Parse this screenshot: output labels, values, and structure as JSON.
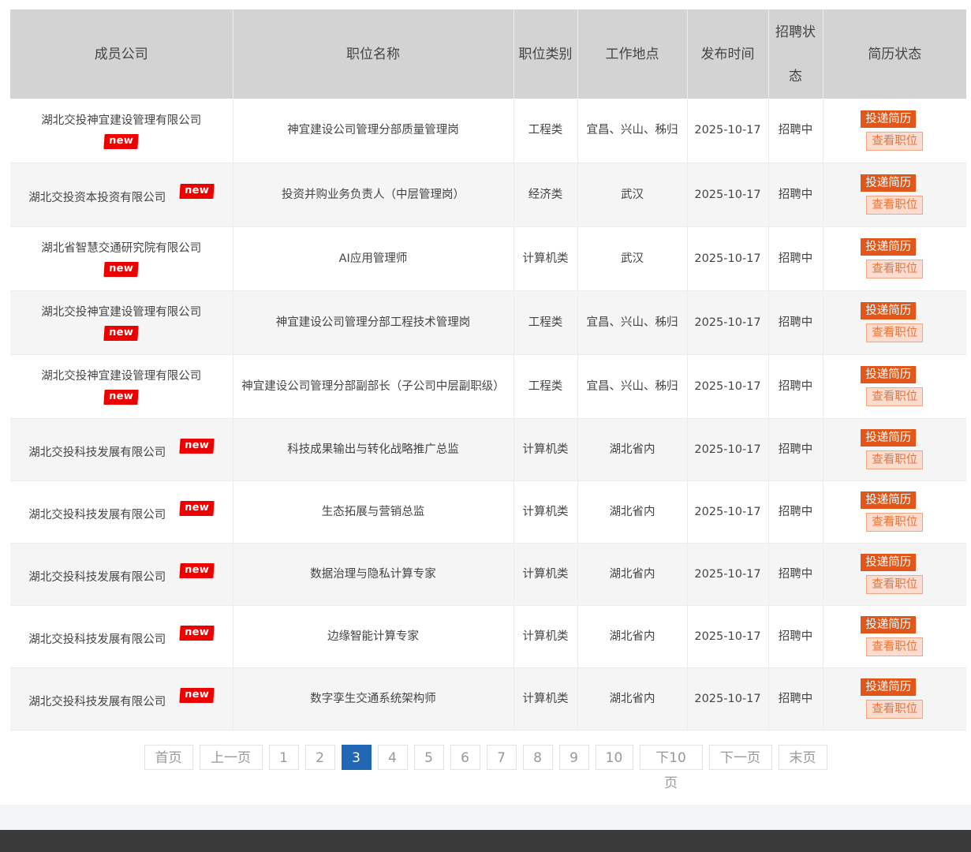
{
  "table": {
    "headers": {
      "company": "成员公司",
      "position": "职位名称",
      "category": "职位类别",
      "location": "工作地点",
      "date": "发布时间",
      "status": "招聘状态",
      "resume": "简历状态"
    },
    "rows": [
      {
        "company": "湖北交投神宜建设管理有限公司",
        "badge": "new",
        "position": "神宜建设公司管理分部质量管理岗",
        "category": "工程类",
        "location": "宜昌、兴山、秭归",
        "date": "2025-10-17",
        "status": "招聘中",
        "apply": "投递简历",
        "view": "查看职位"
      },
      {
        "company": "湖北交投资本投资有限公司",
        "badge": "new",
        "position": "投资并购业务负责人（中层管理岗）",
        "category": "经济类",
        "location": "武汉",
        "date": "2025-10-17",
        "status": "招聘中",
        "apply": "投递简历",
        "view": "查看职位"
      },
      {
        "company": "湖北省智慧交通研究院有限公司",
        "badge": "new",
        "position": "AI应用管理师",
        "category": "计算机类",
        "location": "武汉",
        "date": "2025-10-17",
        "status": "招聘中",
        "apply": "投递简历",
        "view": "查看职位"
      },
      {
        "company": "湖北交投神宜建设管理有限公司",
        "badge": "new",
        "position": "神宜建设公司管理分部工程技术管理岗",
        "category": "工程类",
        "location": "宜昌、兴山、秭归",
        "date": "2025-10-17",
        "status": "招聘中",
        "apply": "投递简历",
        "view": "查看职位"
      },
      {
        "company": "湖北交投神宜建设管理有限公司",
        "badge": "new",
        "position": "神宜建设公司管理分部副部长（子公司中层副职级）",
        "category": "工程类",
        "location": "宜昌、兴山、秭归",
        "date": "2025-10-17",
        "status": "招聘中",
        "apply": "投递简历",
        "view": "查看职位"
      },
      {
        "company": "湖北交投科技发展有限公司",
        "badge": "new",
        "position": "科技成果输出与转化战略推广总监",
        "category": "计算机类",
        "location": "湖北省内",
        "date": "2025-10-17",
        "status": "招聘中",
        "apply": "投递简历",
        "view": "查看职位"
      },
      {
        "company": "湖北交投科技发展有限公司",
        "badge": "new",
        "position": "生态拓展与营销总监",
        "category": "计算机类",
        "location": "湖北省内",
        "date": "2025-10-17",
        "status": "招聘中",
        "apply": "投递简历",
        "view": "查看职位"
      },
      {
        "company": "湖北交投科技发展有限公司",
        "badge": "new",
        "position": "数据治理与隐私计算专家",
        "category": "计算机类",
        "location": "湖北省内",
        "date": "2025-10-17",
        "status": "招聘中",
        "apply": "投递简历",
        "view": "查看职位"
      },
      {
        "company": "湖北交投科技发展有限公司",
        "badge": "new",
        "position": "边缘智能计算专家",
        "category": "计算机类",
        "location": "湖北省内",
        "date": "2025-10-17",
        "status": "招聘中",
        "apply": "投递简历",
        "view": "查看职位"
      },
      {
        "company": "湖北交投科技发展有限公司",
        "badge": "new",
        "position": "数字孪生交通系统架构师",
        "category": "计算机类",
        "location": "湖北省内",
        "date": "2025-10-17",
        "status": "招聘中",
        "apply": "投递简历",
        "view": "查看职位"
      }
    ]
  },
  "pagination": {
    "first": "首页",
    "prev": "上一页",
    "pages": [
      "1",
      "2",
      "3",
      "4",
      "5",
      "6",
      "7",
      "8",
      "9",
      "10"
    ],
    "current_page": "3",
    "next10": "下10页",
    "next": "下一页",
    "last": "末页"
  }
}
